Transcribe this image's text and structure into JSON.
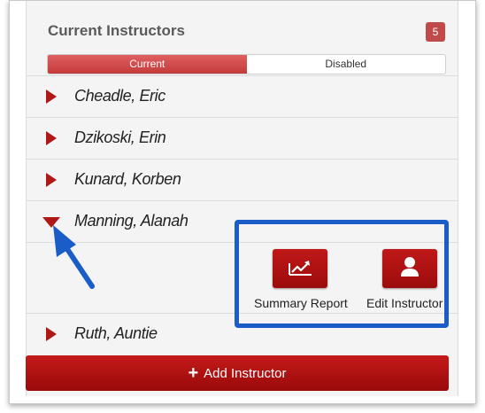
{
  "header": {
    "title": "Current Instructors",
    "count": "5"
  },
  "tabs": [
    {
      "label": "Current",
      "active": true
    },
    {
      "label": "Disabled",
      "active": false
    }
  ],
  "instructors": [
    {
      "name": "Cheadle, Eric",
      "expanded": false
    },
    {
      "name": "Dzikoski, Erin",
      "expanded": false
    },
    {
      "name": "Kunard, Korben",
      "expanded": false
    },
    {
      "name": "Manning, Alanah",
      "expanded": true
    },
    {
      "name": "Ruth, Auntie",
      "expanded": false
    }
  ],
  "actions": {
    "summary_label": "Summary Report",
    "summary_icon": "line-chart-icon",
    "edit_label": "Edit Instructor",
    "edit_icon": "user-icon"
  },
  "add_button": {
    "label": "Add Instructor",
    "icon": "plus-icon"
  },
  "colors": {
    "brand_red": "#b01818",
    "annotation_blue": "#1a5cc8",
    "badge": "#c04a4a"
  }
}
